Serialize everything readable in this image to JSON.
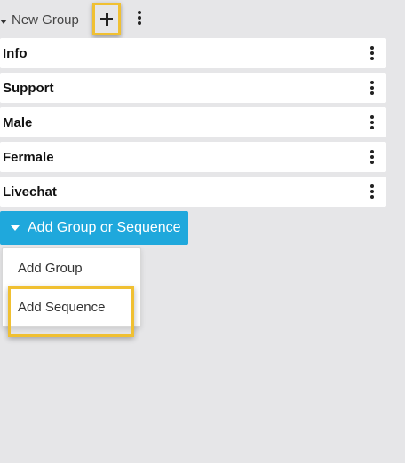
{
  "group": {
    "title": "New Group"
  },
  "rows": [
    {
      "label": "Info"
    },
    {
      "label": "Support"
    },
    {
      "label": "Male"
    },
    {
      "label": "Fermale"
    },
    {
      "label": "Livechat"
    }
  ],
  "add_button": {
    "label": "Add Group or Sequence"
  },
  "dropdown": {
    "items": [
      {
        "label": "Add Group"
      },
      {
        "label": "Add Sequence"
      }
    ]
  },
  "colors": {
    "accent": "#1fa8dc",
    "highlight": "#f0c032",
    "background": "#e6e6e8"
  }
}
